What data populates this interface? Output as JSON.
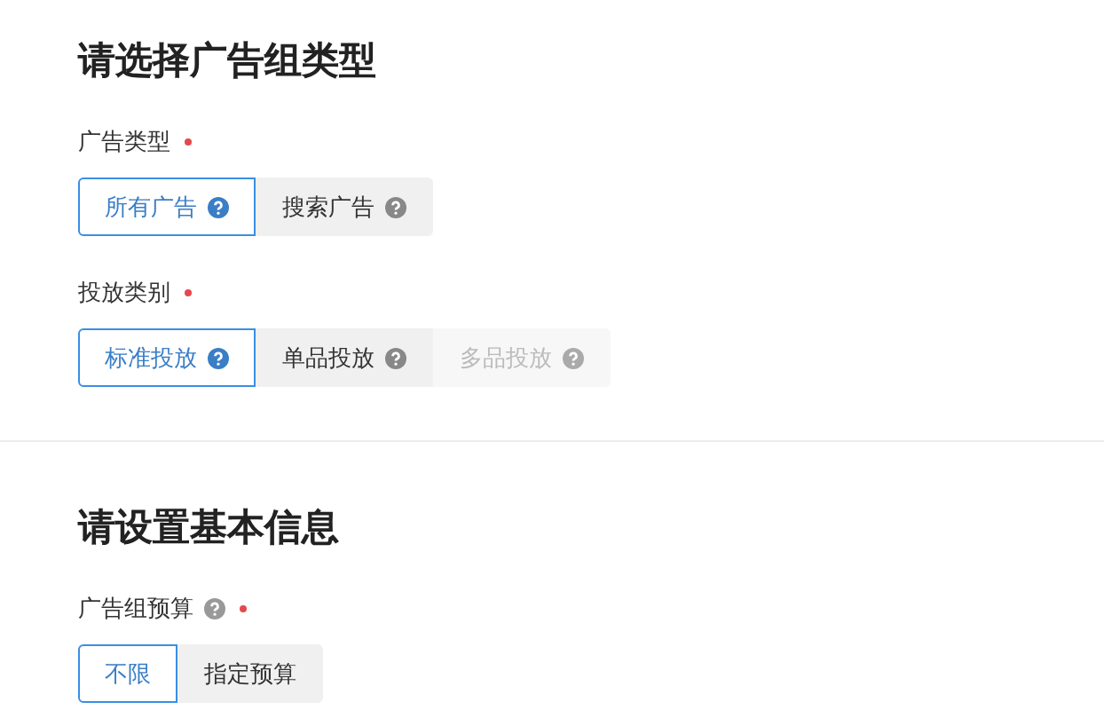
{
  "sections": [
    {
      "title": "请选择广告组类型",
      "fields": [
        {
          "label": "广告类型",
          "help": false,
          "required": true,
          "options": [
            {
              "label": "所有广告",
              "help": true,
              "selected": true,
              "disabled": false
            },
            {
              "label": "搜索广告",
              "help": true,
              "selected": false,
              "disabled": false
            }
          ]
        },
        {
          "label": "投放类别",
          "help": false,
          "required": true,
          "options": [
            {
              "label": "标准投放",
              "help": true,
              "selected": true,
              "disabled": false
            },
            {
              "label": "单品投放",
              "help": true,
              "selected": false,
              "disabled": false
            },
            {
              "label": "多品投放",
              "help": true,
              "selected": false,
              "disabled": true
            }
          ]
        }
      ]
    },
    {
      "title": "请设置基本信息",
      "fields": [
        {
          "label": "广告组预算",
          "help": true,
          "required": true,
          "options": [
            {
              "label": "不限",
              "help": false,
              "selected": true,
              "disabled": false
            },
            {
              "label": "指定预算",
              "help": false,
              "selected": false,
              "disabled": false
            }
          ]
        }
      ]
    }
  ]
}
